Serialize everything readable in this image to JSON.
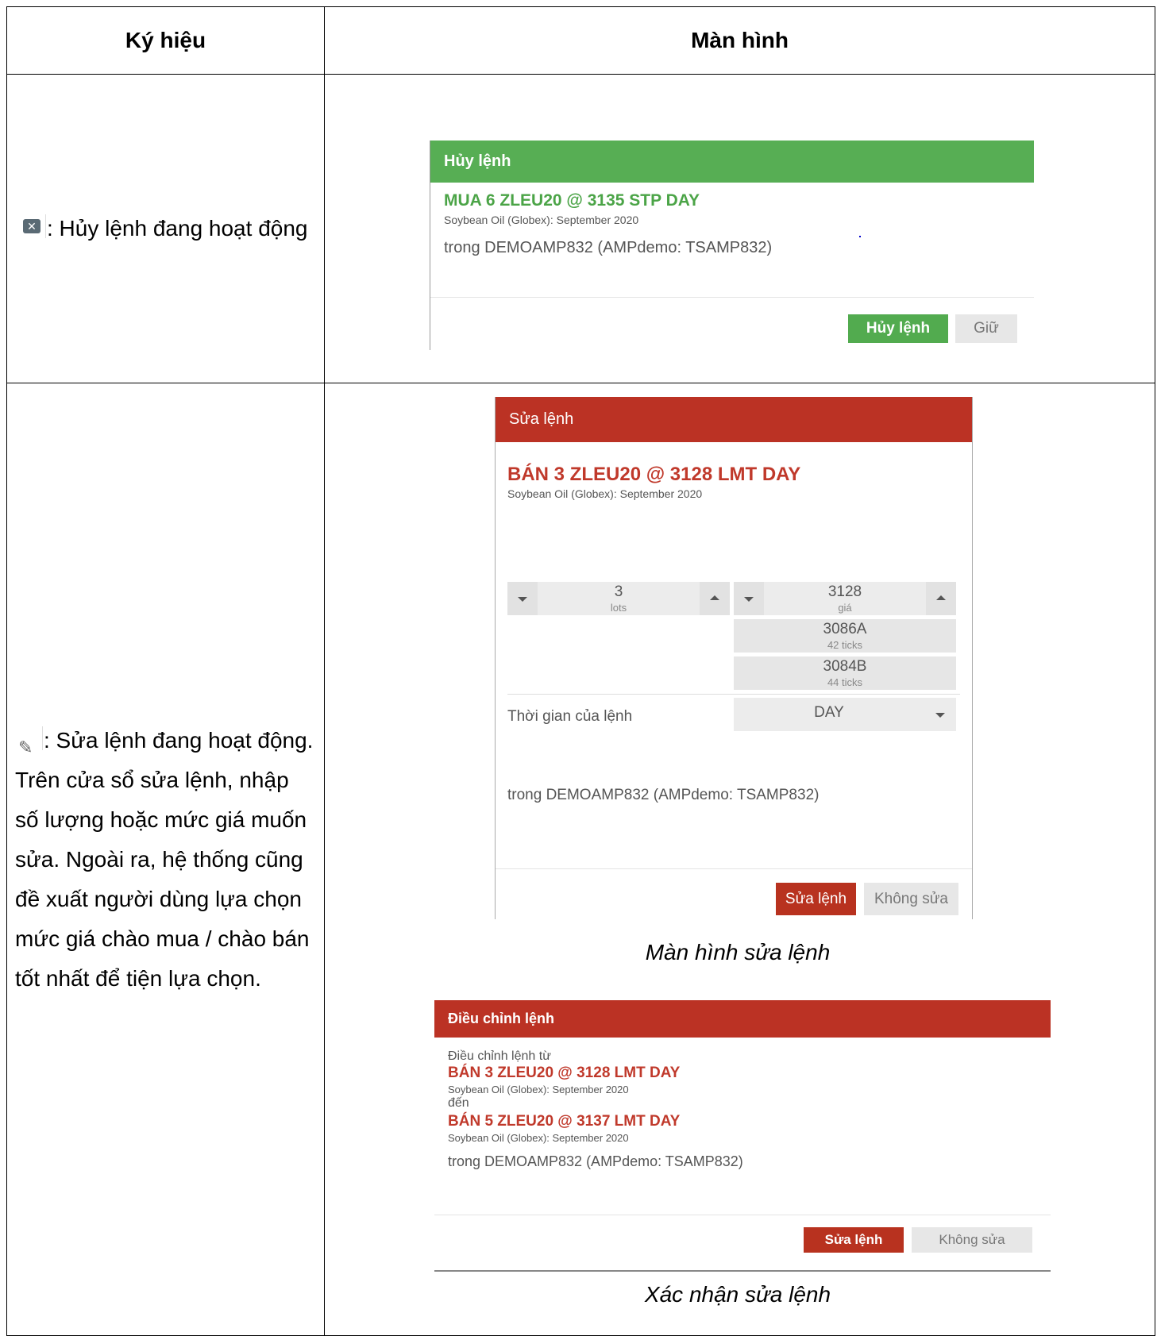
{
  "table": {
    "col1_header": "Ký hiệu",
    "col2_header": "Màn hình"
  },
  "row1": {
    "icon": "cancel-x-icon",
    "description": ": Hủy lệnh đang hoạt động",
    "dialog": {
      "title": "Hủy lệnh",
      "order": "MUA 6 ZLEU20 @ 3135 STP DAY",
      "contract": "Soybean Oil (Globex): September 2020",
      "account": "trong DEMOAMP832 (AMPdemo: TSAMP832)",
      "confirm_label": "Hủy lệnh",
      "keep_label": "Giữ"
    }
  },
  "row2": {
    "icon": "pencil-icon",
    "description_lines": [
      ": Sửa lệnh đang hoạt động.",
      "Trên cửa sổ sửa lệnh, nhập",
      "số lượng hoặc mức giá muốn",
      "sửa. Ngoài ra, hệ thống cũng",
      "đề xuất người dùng lựa chọn",
      "mức giá chào mua / chào bán",
      "tốt nhất để tiện lựa chọn."
    ],
    "edit_dialog": {
      "title": "Sửa lệnh",
      "order": "BÁN 3 ZLEU20 @ 3128 LMT DAY",
      "contract": "Soybean Oil (Globex): September 2020",
      "qty_value": "3",
      "qty_unit": "lots",
      "price_value": "3128",
      "price_unit": "giá",
      "suggestions": [
        {
          "price": "3086A",
          "ticks": "42 ticks"
        },
        {
          "price": "3084B",
          "ticks": "44 ticks"
        }
      ],
      "tif_label": "Thời gian của lệnh",
      "tif_value": "DAY",
      "account": "trong DEMOAMP832 (AMPdemo: TSAMP832)",
      "confirm_label": "Sửa lệnh",
      "cancel_label": "Không sửa",
      "caption": "Màn hình sửa lệnh"
    },
    "confirm_dialog": {
      "title": "Điều chỉnh lệnh",
      "from_label": "Điều chỉnh lệnh từ",
      "from_order": "BÁN 3 ZLEU20 @ 3128 LMT DAY",
      "from_contract": "Soybean Oil (Globex): September 2020",
      "to_label": "đến",
      "to_order": "BÁN 5 ZLEU20 @ 3137 LMT DAY",
      "to_contract": "Soybean Oil (Globex): September 2020",
      "account": "trong DEMOAMP832 (AMPdemo: TSAMP832)",
      "confirm_label": "Sửa lệnh",
      "cancel_label": "Không sửa",
      "caption": "Xác nhận sửa lệnh"
    }
  }
}
